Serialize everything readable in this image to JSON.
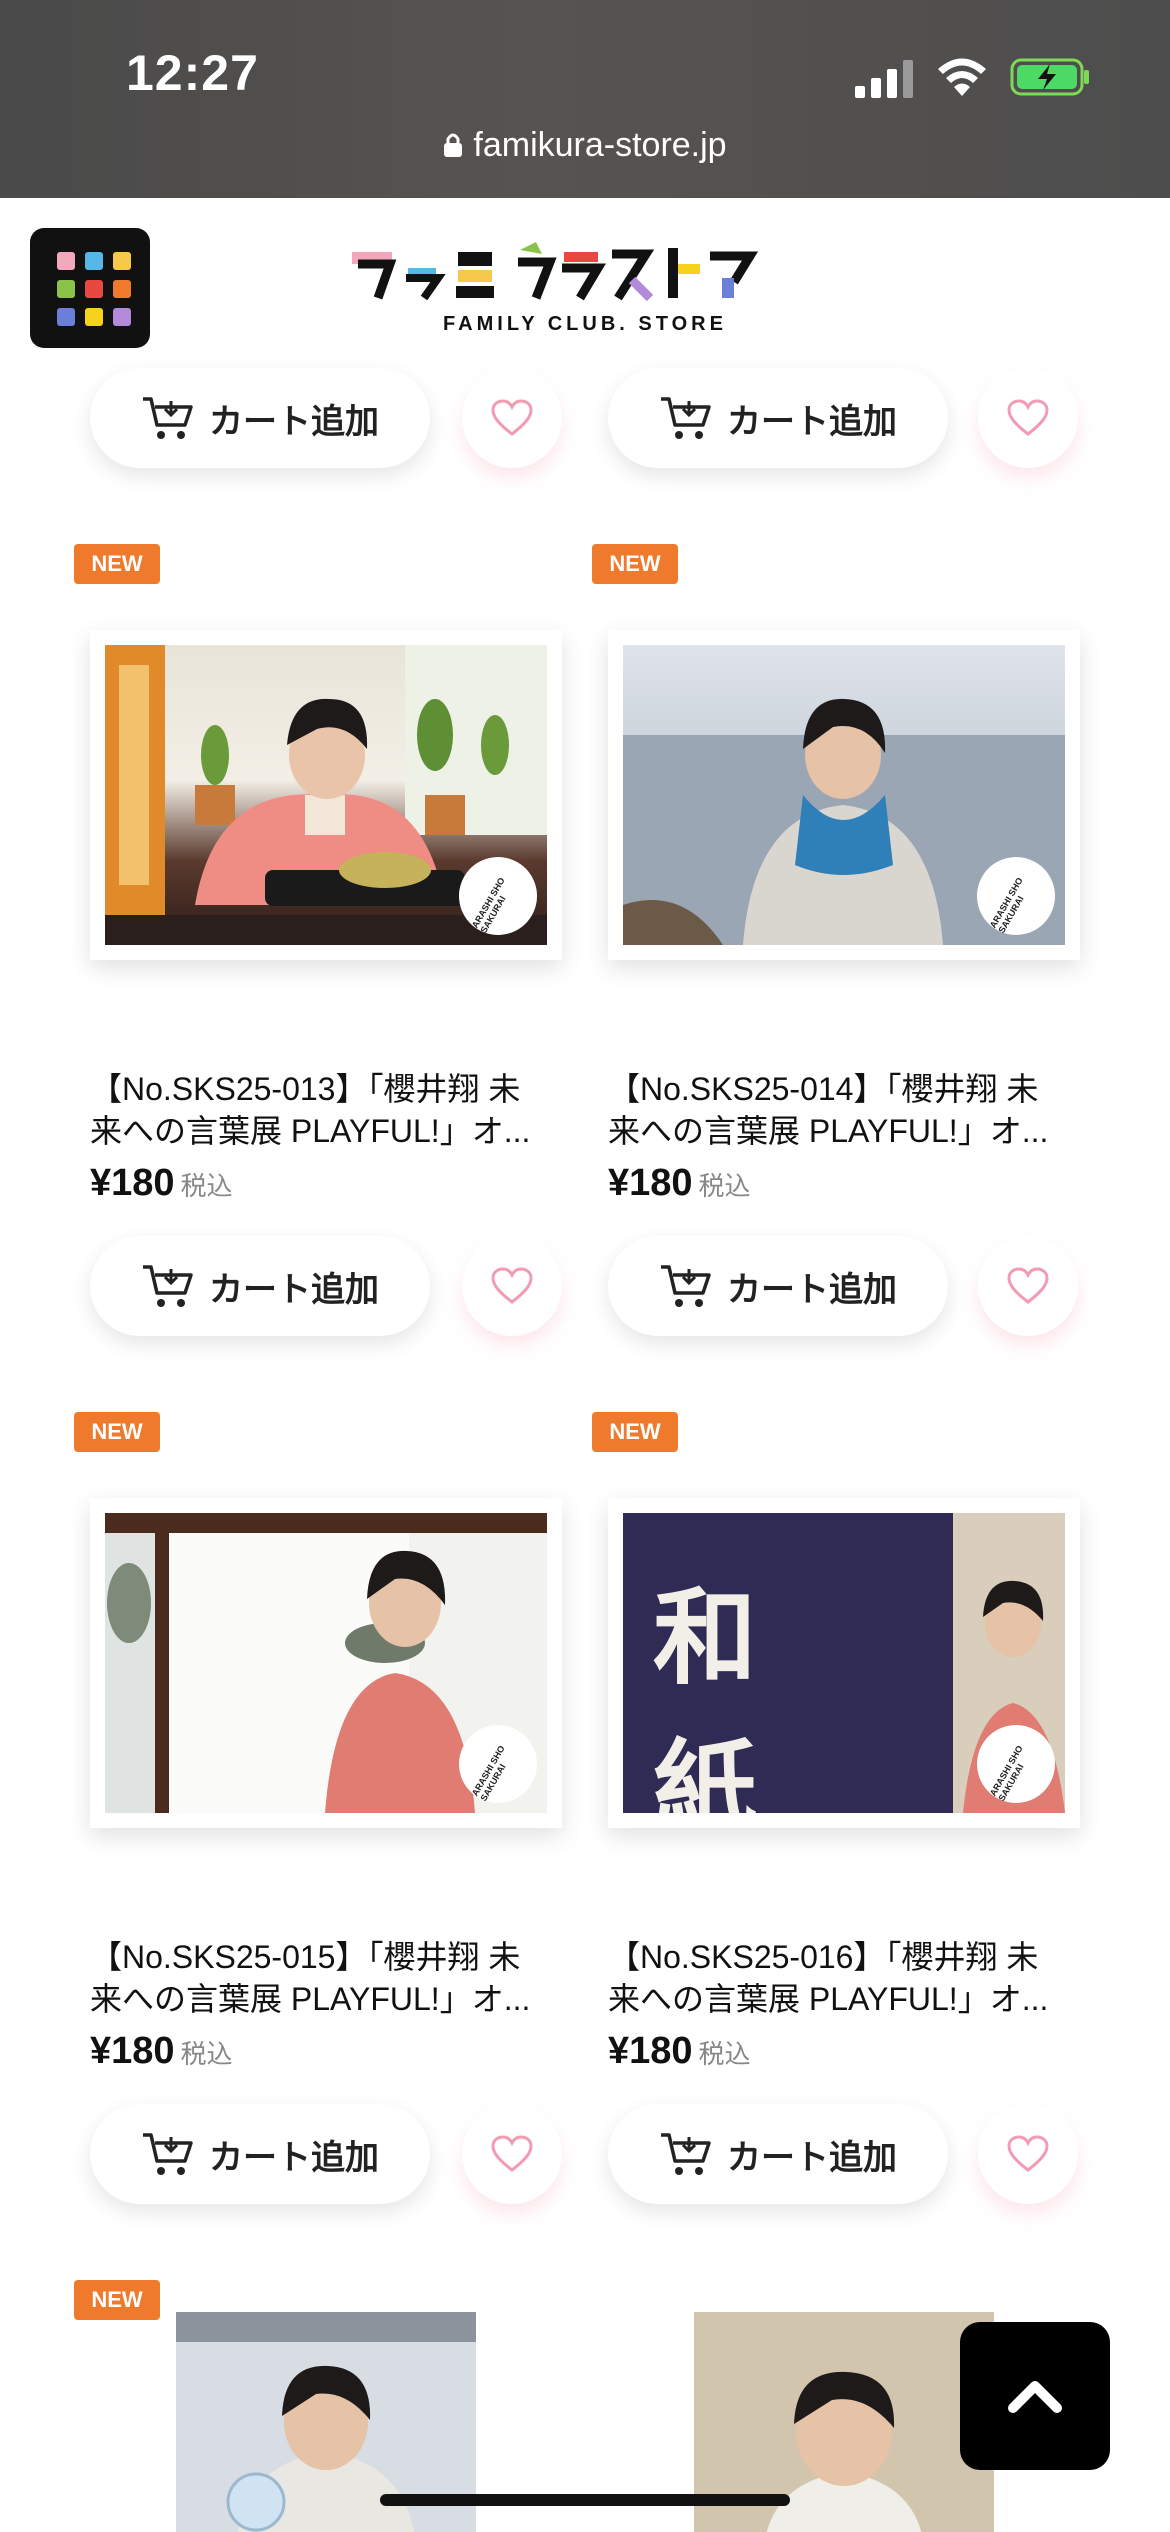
{
  "status_bar": {
    "time": "12:27"
  },
  "browser": {
    "url": "famikura-store.jp"
  },
  "header": {
    "logo_text": "ファミクラストア",
    "logo_sub": "FAMILY CLUB. STORE",
    "menu_colors": [
      "#f3a7bd",
      "#56b8e6",
      "#f7c94b",
      "#8bc34a",
      "#e7483f",
      "#f07a2b",
      "#6c7fd8",
      "#f7d21c",
      "#b38ad9"
    ]
  },
  "top_row": {
    "cart_label": "カート追加"
  },
  "products": [
    {
      "badge": "NEW",
      "title_line1": "【No.SKS25-013】「櫻井翔 未",
      "title_line2": "来への言葉展 PLAYFUL!」オ...",
      "price": "¥180",
      "tax": "税込",
      "cart_label": "カート追加",
      "stamp": "ARASHI SHO SAKURAI"
    },
    {
      "badge": "NEW",
      "title_line1": "【No.SKS25-014】「櫻井翔 未",
      "title_line2": "来への言葉展 PLAYFUL!」オ...",
      "price": "¥180",
      "tax": "税込",
      "cart_label": "カート追加",
      "stamp": "ARASHI SHO SAKURAI"
    },
    {
      "badge": "NEW",
      "title_line1": "【No.SKS25-015】「櫻井翔 未",
      "title_line2": "来への言葉展 PLAYFUL!」オ...",
      "price": "¥180",
      "tax": "税込",
      "cart_label": "カート追加",
      "stamp": "ARASHI SHO SAKURAI"
    },
    {
      "badge": "NEW",
      "title_line1": "【No.SKS25-016】「櫻井翔 未",
      "title_line2": "来への言葉展 PLAYFUL!」オ...",
      "price": "¥180",
      "tax": "税込",
      "cart_label": "カート追加",
      "stamp": "ARASHI SHO SAKURAI",
      "curtain_text": "和 紙"
    },
    {
      "badge": "NEW"
    }
  ],
  "colors": {
    "accent_badge": "#f07a2b",
    "heart": "#f29bb3"
  }
}
